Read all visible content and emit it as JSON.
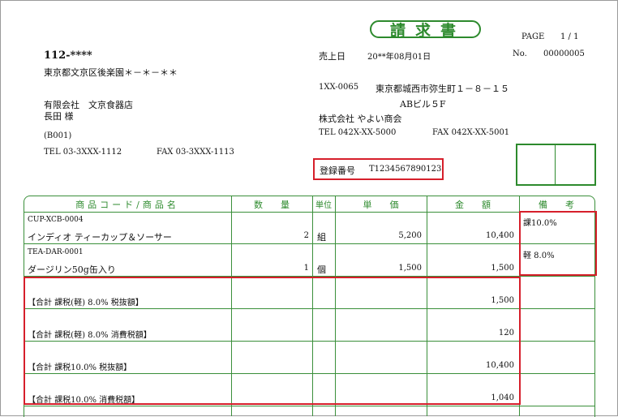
{
  "document": {
    "title": "請求書",
    "page_label": "PAGE",
    "page_value": "1 / 1",
    "sale_date_label": "売上日",
    "sale_date": "20**年08月01日",
    "number_label": "No.",
    "number": "00000005"
  },
  "customer": {
    "postal": "112-****",
    "address": "東京都文京区後楽園＊－＊－＊＊",
    "company": "有限会社　文京食器店",
    "person": "長田 様",
    "code": "(B001)",
    "tel": "TEL 03-3XXX-1112",
    "fax": "FAX 03-3XXX-1113"
  },
  "issuer": {
    "postal": "1XX-0065",
    "address1": "東京都城西市弥生町１－８－１５",
    "address2": "ABビル５F",
    "company": "株式会社 やよい商会",
    "tel": "TEL 042X-XX-5000",
    "fax": "FAX 042X-XX-5001",
    "registration_label": "登録番号",
    "registration_number": "T1234567890123"
  },
  "table": {
    "headers": {
      "item": "商品コード/商品名",
      "qty": "数　　量",
      "unit": "単位",
      "price": "単　　価",
      "amount": "金　　額",
      "note": "備　　考"
    },
    "rows": [
      {
        "code": "CUP-XCB-0004",
        "name": "インディオ ティーカップ＆ソーサー",
        "qty": "2",
        "unit": "組",
        "price": "5,200",
        "amount": "10,400",
        "note": "課10.0%"
      },
      {
        "code": "TEA-DAR-0001",
        "name": "ダージリン50g缶入り",
        "qty": "1",
        "unit": "個",
        "price": "1,500",
        "amount": "1,500",
        "note": "軽 8.0%"
      }
    ],
    "totals": [
      {
        "label": "【合計 課税(軽) 8.0% 税抜額】",
        "amount": "1,500"
      },
      {
        "label": "【合計 課税(軽) 8.0% 消費税額】",
        "amount": "120"
      },
      {
        "label": "【合計 課税10.0% 税抜額】",
        "amount": "10,400"
      },
      {
        "label": "【合計 課税10.0% 消費税額】",
        "amount": "1,040"
      }
    ]
  },
  "colors": {
    "accent_green": "#2d8a2d",
    "highlight_red": "#d61f2b"
  }
}
